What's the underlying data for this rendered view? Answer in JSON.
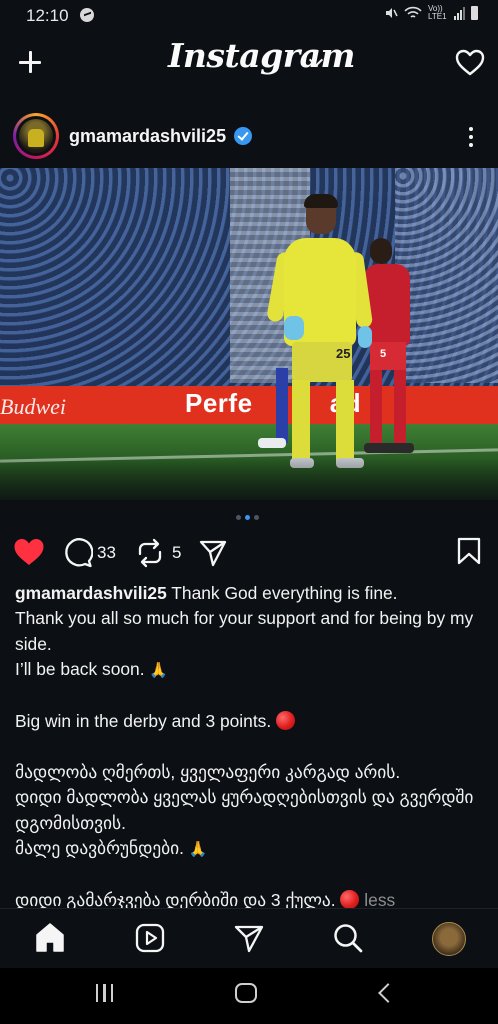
{
  "status_bar": {
    "time": "12:10",
    "network_label": "Vo)) LTE1"
  },
  "header": {
    "logo": "Instagram",
    "icons": [
      "plus-icon",
      "chevron-down-icon",
      "heart-icon"
    ]
  },
  "post": {
    "username": "gmamardashvili25",
    "verified": true,
    "photo": {
      "billboard_left": "Budwei",
      "billboard_text": "Perfe          ad",
      "gk_number": "25",
      "red_player_number": "5"
    },
    "carousel": {
      "count": 3,
      "active": 2
    },
    "actions": {
      "liked": true,
      "comments": "33",
      "reposts": "5"
    },
    "caption": {
      "username": "gmamardashvili25",
      "lines": [
        "Thank God everything is fine.",
        "Thank you all so much for your support and for being by my side.",
        "I’ll be back soon.",
        "",
        "Big win in the derby and 3 points.",
        "",
        "მადლობა ღმერთს, ყველაფერი კარგად არის.",
        "დიდი მადლობა ყველას ყურადღებისთვის და გვერდში დგომისთვის.",
        "მალე დავბრუნდები.",
        "",
        "დიდი გამარჯვება დერბიში და 3 ქულა."
      ],
      "more_label": "less"
    }
  },
  "bottom_nav": {
    "items": [
      "home-icon",
      "reels-icon",
      "send-icon",
      "search-icon",
      "profile-avatar"
    ]
  },
  "colors": {
    "background": "#0c1014",
    "like_red": "#ff3040",
    "verified_blue": "#3897f0",
    "muted": "#8e8e8e"
  }
}
